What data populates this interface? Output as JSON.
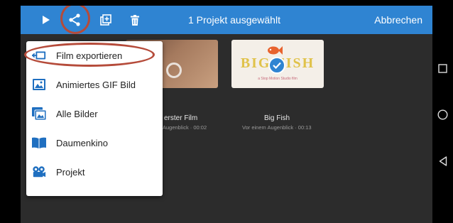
{
  "topbar": {
    "title": "1 Projekt ausgewählt",
    "cancel_label": "Abbrechen",
    "icons": [
      "play-icon",
      "share-icon",
      "duplicate-icon",
      "trash-icon"
    ]
  },
  "projects": [
    {
      "title": "erster Film",
      "subtitle": "Augenblick · 00:02"
    },
    {
      "title": "Big Fish",
      "subtitle": "Vor einem Augenblick · 00:13",
      "selected": true,
      "thumb_text": "BIG FISH",
      "thumb_caption": "a Stop Motion Studio film"
    }
  ],
  "share_menu": {
    "items": [
      {
        "label": "Film exportieren",
        "icon": "film-export-icon"
      },
      {
        "label": "Animiertes GIF Bild",
        "icon": "gif-image-icon"
      },
      {
        "label": "Alle Bilder",
        "icon": "all-images-icon"
      },
      {
        "label": "Daumenkino",
        "icon": "flipbook-icon"
      },
      {
        "label": "Projekt",
        "icon": "project-camera-icon"
      }
    ]
  },
  "colors": {
    "accent": "#2f84d2",
    "annotation": "#b54b3a",
    "menu_icon": "#1f6fc0"
  },
  "nav": [
    "recents-icon",
    "home-icon",
    "back-icon"
  ]
}
